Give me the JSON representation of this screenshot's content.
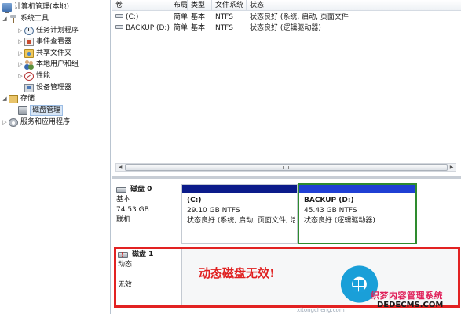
{
  "tree": {
    "root": "计算机管理(本地)",
    "system_tools": "系统工具",
    "task_scheduler": "任务计划程序",
    "event_viewer": "事件查看器",
    "shared_folders": "共享文件夹",
    "local_users": "本地用户和组",
    "performance": "性能",
    "device_manager": "设备管理器",
    "storage": "存储",
    "disk_management": "磁盘管理",
    "services_apps": "服务和应用程序"
  },
  "volumes": {
    "headers": [
      "卷",
      "布局",
      "类型",
      "文件系统",
      "状态"
    ],
    "rows": [
      {
        "name": "(C:)",
        "layout": "简单",
        "type": "基本",
        "fs": "NTFS",
        "status": "状态良好 (系统, 启动, 页面文件"
      },
      {
        "name": "BACKUP (D:)",
        "layout": "简单",
        "type": "基本",
        "fs": "NTFS",
        "status": "状态良好 (逻辑驱动器)"
      }
    ]
  },
  "disk0": {
    "title": "磁盘 0",
    "type": "基本",
    "size": "74.53 GB",
    "state": "联机",
    "partitions": [
      {
        "name": "(C:)",
        "size": "29.10 GB NTFS",
        "status": "状态良好 (系统, 启动, 页面文件, 活",
        "fill": 1.0
      },
      {
        "name": "BACKUP  (D:)",
        "size": "45.43 GB NTFS",
        "status": "状态良好 (逻辑驱动器)",
        "fill": 1.0
      }
    ]
  },
  "disk1": {
    "title": "磁盘 1",
    "type": "动态",
    "state": "无效",
    "annotation": "动态磁盘无效!"
  },
  "watermark": {
    "brand": "织梦内容管理系统",
    "domain": "DEDECMS.COM",
    "sub": "xitongcheng.com"
  },
  "colors": {
    "primary_partition_bar": "#0b1b8a",
    "logical_partition_bar": "#1f3fd4",
    "selected_partition_border": "#2e8b2e",
    "annotation_red": "#e22222"
  }
}
